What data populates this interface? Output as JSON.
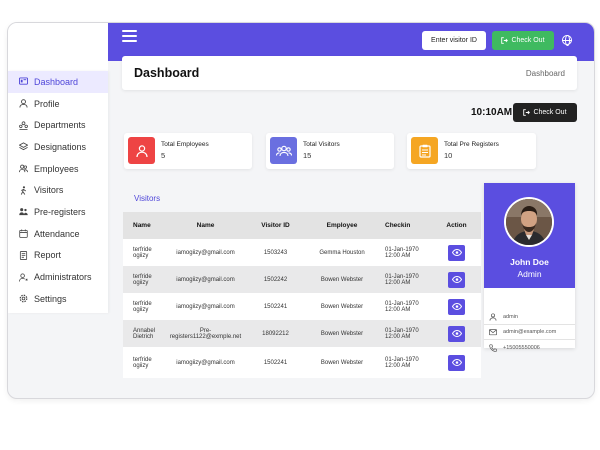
{
  "topbar": {
    "visitor_button": "Enter visitor ID",
    "checkout_button": "Check Out"
  },
  "sidebar": {
    "items": [
      {
        "label": "Dashboard",
        "icon": "dashboard-icon",
        "active": true
      },
      {
        "label": "Profile",
        "icon": "user-icon"
      },
      {
        "label": "Departments",
        "icon": "departments-icon"
      },
      {
        "label": "Designations",
        "icon": "layers-icon"
      },
      {
        "label": "Employees",
        "icon": "employees-icon"
      },
      {
        "label": "Visitors",
        "icon": "walking-icon"
      },
      {
        "label": "Pre-registers",
        "icon": "users-icon"
      },
      {
        "label": "Attendance",
        "icon": "calendar-icon"
      },
      {
        "label": "Report",
        "icon": "report-icon"
      },
      {
        "label": "Administrators",
        "icon": "admin-icon"
      },
      {
        "label": "Settings",
        "icon": "gear-icon"
      }
    ]
  },
  "header": {
    "title": "Dashboard",
    "breadcrumb": "Dashboard"
  },
  "clock": {
    "time": "10:10AM",
    "checkout_button": "Check Out"
  },
  "stats": [
    {
      "label": "Total Employees",
      "value": "5",
      "color": "#ee4444",
      "icon": "employee-card-icon"
    },
    {
      "label": "Total Visitors",
      "value": "15",
      "color": "#6a6fe0",
      "icon": "group-icon"
    },
    {
      "label": "Total Pre Registers",
      "value": "10",
      "color": "#f5a623",
      "icon": "clipboard-icon"
    }
  ],
  "visitors": {
    "title": "Visitors",
    "columns": [
      "Name",
      "Name",
      "Visitor ID",
      "Employee",
      "Checkin",
      "Action"
    ],
    "rows": [
      {
        "name": "terfride ogiizy",
        "email": "iamogiizy@gmail.com",
        "visitor_id": "1503243",
        "employee": "Gemma Houston",
        "checkin": "01-Jan-1970 12:00 AM"
      },
      {
        "name": "terfride ogiizy",
        "email": "iamogiizy@gmail.com",
        "visitor_id": "1502242",
        "employee": "Bowen Webster",
        "checkin": "01-Jan-1970 12:00 AM"
      },
      {
        "name": "terfride ogiizy",
        "email": "iamogiizy@gmail.com",
        "visitor_id": "1502241",
        "employee": "Bowen Webster",
        "checkin": "01-Jan-1970 12:00 AM"
      },
      {
        "name": "Annabel Dietrich",
        "email": "Pre-registers1122@exmple.net",
        "visitor_id": "18092212",
        "employee": "Bowen Webster",
        "checkin": "01-Jan-1970 12:00 AM"
      },
      {
        "name": "terfride ogiizy",
        "email": "iamogiizy@gmail.com",
        "visitor_id": "1502241",
        "employee": "Bowen Webster",
        "checkin": "01-Jan-1970 12:00 AM"
      }
    ]
  },
  "profile": {
    "name": "John Doe",
    "role": "Admin",
    "username": "admin",
    "email": "admin@example.com",
    "phone": "+15005550006"
  },
  "colors": {
    "accent": "#5b4ee0",
    "checkout_green": "#3fba60",
    "dark_button": "#222222"
  }
}
